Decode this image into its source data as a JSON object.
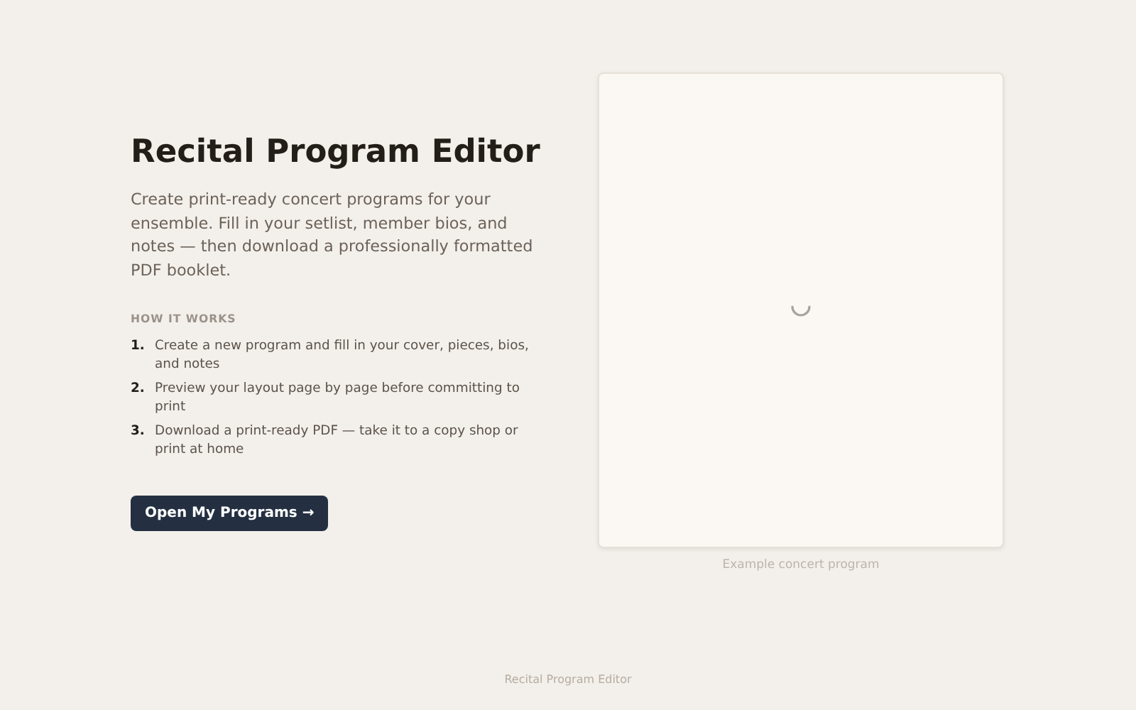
{
  "hero": {
    "title": "Recital Program Editor",
    "description": "Create print-ready concert programs for your ensemble. Fill in your setlist, member bios, and notes — then download a professionally formatted PDF booklet.",
    "steps_heading": "HOW IT WORKS",
    "steps": [
      {
        "number": "1.",
        "text": "Create a new program and fill in your cover, pieces, bios, and notes"
      },
      {
        "number": "2.",
        "text": "Preview your layout page by page before committing to print"
      },
      {
        "number": "3.",
        "text": "Download a print-ready PDF — take it to a copy shop or print at home"
      }
    ],
    "button": "Open My Programs →"
  },
  "preview": {
    "loading": true,
    "caption": "Example concert program"
  },
  "footer": "Recital Program Editor"
}
